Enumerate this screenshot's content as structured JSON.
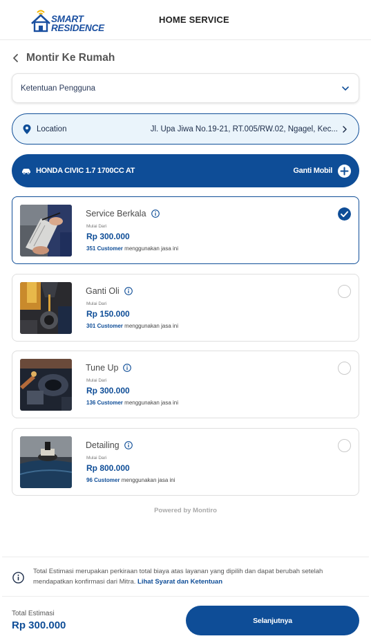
{
  "app": {
    "brand_line1": "SMART",
    "brand_line2": "RESIDENCE",
    "header_title": "HOME SERVICE",
    "logo_icon": "house-wifi-logo"
  },
  "page": {
    "title": "Montir Ke Rumah",
    "back_icon": "chevron-left-icon"
  },
  "terms_dropdown": {
    "label": "Ketentuan Pengguna",
    "icon": "chevron-down-icon"
  },
  "location": {
    "label": "Location",
    "address": "Jl. Upa Jiwa No.19-21, RT.005/RW.02, Ngagel, Kec...",
    "icon": "location-pin-icon"
  },
  "vehicle": {
    "name": "HONDA CIVIC 1.7 1700CC AT",
    "change_label": "Ganti Mobil",
    "icon": "car-icon"
  },
  "services": [
    {
      "name": "Service Berkala",
      "from_label": "Mulai Dari",
      "price": "Rp 300.000",
      "customers": "351 Customer",
      "usage_suffix": "menggunakan jasa ini",
      "selected": true,
      "image": "mechanic-clipboard-photo"
    },
    {
      "name": "Ganti Oli",
      "from_label": "Mulai Dari",
      "price": "Rp 150.000",
      "customers": "301 Customer",
      "usage_suffix": "menggunakan jasa ini",
      "selected": false,
      "image": "oil-pouring-photo"
    },
    {
      "name": "Tune Up",
      "from_label": "Mulai Dari",
      "price": "Rp 300.000",
      "customers": "136 Customer",
      "usage_suffix": "menggunakan jasa ini",
      "selected": false,
      "image": "engine-bay-photo"
    },
    {
      "name": "Detailing",
      "from_label": "Mulai Dari",
      "price": "Rp 800.000",
      "customers": "96 Customer",
      "usage_suffix": "menggunakan jasa ini",
      "selected": false,
      "image": "car-polishing-photo"
    }
  ],
  "powered_by": "Powered by Montiro",
  "notice": {
    "text": "Total Estimasi merupakan perkiraan total biaya atas layanan yang dipilih dan dapat berubah setelah mendapatkan konfirmasi dari Mitra.",
    "link": "Lihat Syarat dan Ketentuan",
    "icon": "info-icon"
  },
  "footer": {
    "total_label": "Total Estimasi",
    "total_value": "Rp 300.000",
    "next_label": "Selanjutnya"
  },
  "colors": {
    "primary": "#0e4d97",
    "location_bg": "#eaf4fb",
    "border": "#dedede"
  }
}
